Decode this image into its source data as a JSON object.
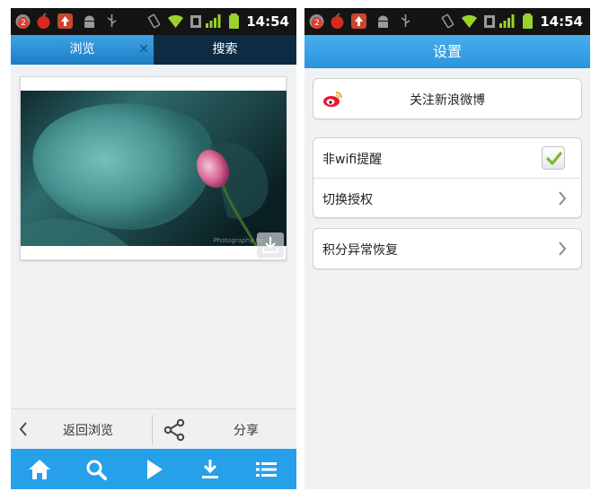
{
  "status_bar": {
    "time": "14:54",
    "notification_badge": "2",
    "icons": [
      "app-icon",
      "cherry-icon",
      "upload-icon",
      "android-icon",
      "usb-icon",
      "vibrate-icon",
      "wifi-icon",
      "sim-icon",
      "signal-icon",
      "battery-icon"
    ]
  },
  "browse_screen": {
    "tabs": [
      {
        "label": "浏览",
        "active": true
      },
      {
        "label": "搜索",
        "active": false
      }
    ],
    "close_icon": "close-icon",
    "image_download_icon": "download-icon",
    "photo_credit": "Photography by",
    "action_bar": {
      "back_label": "返回浏览",
      "share_label": "分享",
      "back_icon": "chevron-left-icon",
      "share_icon": "share-icon"
    },
    "toolbar": [
      {
        "name": "home",
        "icon": "home-icon"
      },
      {
        "name": "search",
        "icon": "search-icon"
      },
      {
        "name": "play",
        "icon": "play-icon"
      },
      {
        "name": "download",
        "icon": "download-icon"
      },
      {
        "name": "menu",
        "icon": "list-icon"
      }
    ]
  },
  "settings_screen": {
    "title": "设置",
    "follow_label": "关注新浪微博",
    "follow_icon": "weibo-icon",
    "items": [
      {
        "label": "非wifi提醒",
        "control": "checkbox",
        "checked": true
      },
      {
        "label": "切换授权",
        "control": "chevron"
      },
      {
        "label": "积分异常恢复",
        "control": "chevron"
      }
    ]
  },
  "colors": {
    "accent_blue": "#27a0ea",
    "status_bar": "#141414",
    "dark_tab": "#0d2c43",
    "check_green": "#7cb82f",
    "weibo_red": "#e6162d"
  }
}
